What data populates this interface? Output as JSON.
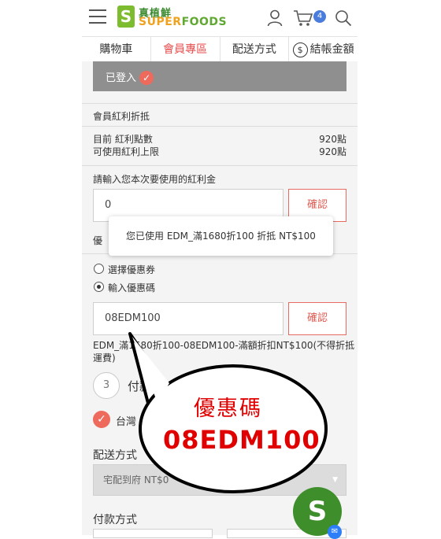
{
  "header": {
    "logo_mark": "S",
    "logo_cn": "真植鮮",
    "logo_en_prefix": "SUPER",
    "logo_en_suffix": "FOODS",
    "cart_count": "4"
  },
  "tabs": [
    {
      "label": "購物車"
    },
    {
      "label": "會員專區"
    },
    {
      "label": "配送方式"
    },
    {
      "label": "結帳金額",
      "icon": "$"
    }
  ],
  "member": {
    "logged_in_text": "已登入",
    "bonus_section_title": "會員紅利折抵",
    "current_points_label": "目前 紅利點數",
    "current_points_value": "920點",
    "usable_limit_label": "可使用紅利上限",
    "usable_limit_value": "920點",
    "bonus_input_label": "請輸入您本次要使用的紅利金",
    "bonus_input_value": "0",
    "confirm_label": "確認"
  },
  "tooltip": {
    "text": "您已使用 EDM_滿1680折100 折抵 NT$100"
  },
  "coupon": {
    "section_title_partial": "優",
    "option_select": "選擇優惠券",
    "option_enter": "輸入優惠碼",
    "code_value": "08EDM100",
    "confirm_label": "確認",
    "result_line1": "EDM_滿1680折100-08EDM100-滿額折扣NT$100(不得折抵",
    "result_line2": "運費)"
  },
  "step3": {
    "number": "3",
    "label_partial": "付款"
  },
  "agree": {
    "text_partial": "台灣"
  },
  "shipping": {
    "label": "配送方式",
    "selected": "宅配到府 NT$0"
  },
  "payment": {
    "label": "付款方式"
  },
  "callout": {
    "title": "優惠碼",
    "code": "08EDM100"
  },
  "colors": {
    "accent_red": "#e84c4c",
    "brand_green": "#5fa831",
    "badge_blue": "#4a7cdb"
  }
}
